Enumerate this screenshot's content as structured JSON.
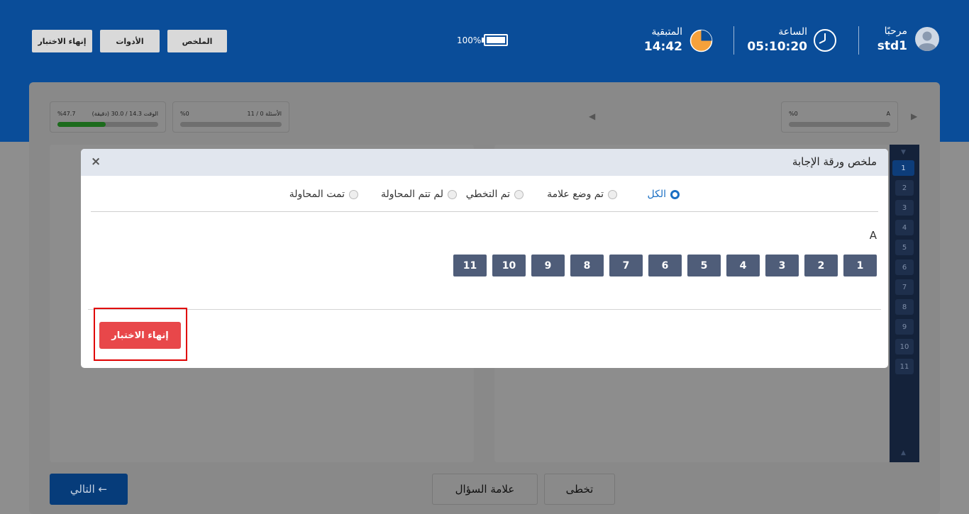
{
  "header": {
    "buttons": [
      {
        "label": "إنهاء الاختبار"
      },
      {
        "label": "الأدوات"
      },
      {
        "label": "الملخص"
      }
    ],
    "battery_percent": "100%",
    "remaining": {
      "label": "المتبقية",
      "value": "14:42"
    },
    "clock": {
      "label": "الساعة",
      "value": "05:10:20"
    },
    "user": {
      "greeting": "مرحبًا",
      "name": "std1"
    }
  },
  "stats_bar": {
    "time_card": {
      "percent": "%47.7",
      "text": "الوقت 14.3 / 30.0 (دقيقة)",
      "progress": 0.477
    },
    "questions_card": {
      "percent": "%0",
      "text": "الأسئلة 0 / 11",
      "progress": 0
    },
    "section_card": {
      "percent": "%0",
      "text": "A",
      "progress": 0
    }
  },
  "sidenav": {
    "items": [
      "1",
      "2",
      "3",
      "4",
      "5",
      "6",
      "7",
      "8",
      "9",
      "10",
      "11"
    ],
    "active": "1"
  },
  "bottom": {
    "next_label": "التالي ←",
    "flag_label": "علامة السؤال",
    "skip_label": "تخطى"
  },
  "modal": {
    "title": "ملخص ورقة الإجابة",
    "close_glyph": "×",
    "filters": [
      {
        "label": "الكل",
        "checked": true
      },
      {
        "label": "تم وضع علامة",
        "checked": false
      },
      {
        "label": "تم التخطي",
        "checked": false
      },
      {
        "label": "لم تتم المحاولة",
        "checked": false
      },
      {
        "label": "تمت المحاولة",
        "checked": false
      }
    ],
    "section_label": "A",
    "questions": [
      "1",
      "2",
      "3",
      "4",
      "5",
      "6",
      "7",
      "8",
      "9",
      "10",
      "11"
    ],
    "end_button": "إنهاء الاختبار"
  },
  "colors": {
    "header_blue": "#0a4d99",
    "question_button": "#4f5d79",
    "end_button": "#e8474a",
    "highlight": "#e00000",
    "active_radio": "#1a6fc4"
  }
}
